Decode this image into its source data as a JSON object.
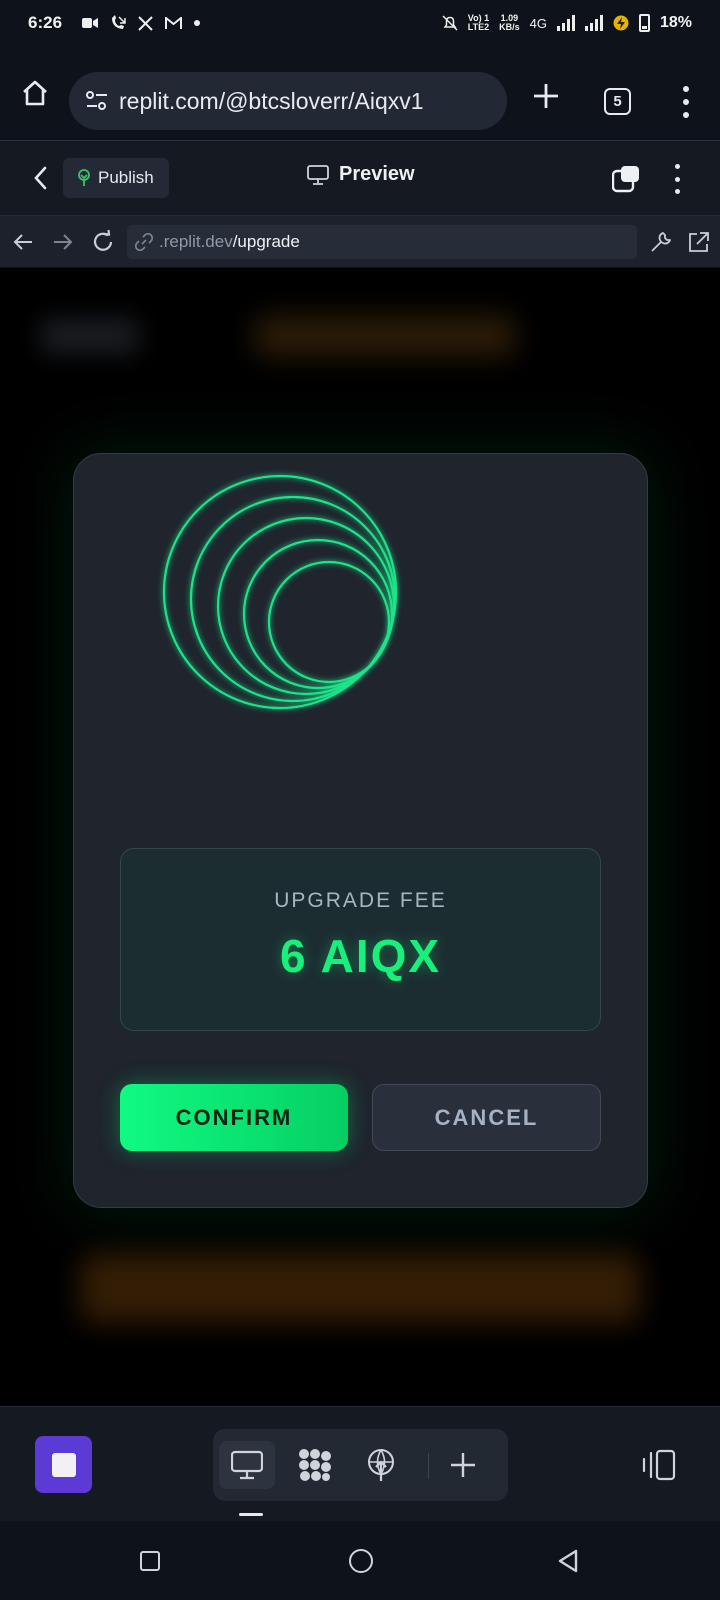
{
  "status_bar": {
    "time": "6:26",
    "volte_line1": "Vo) 1",
    "volte_line2": "LTE2",
    "speed_line1": "1.09",
    "speed_line2": "KB/s",
    "network": "4G",
    "battery": "18%"
  },
  "browser": {
    "url": "replit.com/@btcsloverr/Aiqxv1",
    "tab_count": "5"
  },
  "toolbar": {
    "publish_label": "Publish",
    "preview_label": "Preview"
  },
  "preview_nav": {
    "url_domain": ".replit.dev",
    "url_path": "/upgrade"
  },
  "modal": {
    "fee_label": "UPGRADE FEE",
    "fee_value": "6 AIQX",
    "confirm_label": "CONFIRM",
    "cancel_label": "CANCEL",
    "accent_color": "#19f07c"
  },
  "icons": [
    "home-icon",
    "site-settings-icon",
    "plus-icon",
    "tabs-icon",
    "menu-icon",
    "chevron-left-icon",
    "publish-icon",
    "monitor-icon",
    "windows-icon",
    "arrow-left-icon",
    "arrow-right-icon",
    "reload-icon",
    "link-icon",
    "wrench-icon",
    "external-link-icon",
    "stop-icon",
    "grid-blob-icon",
    "deploy-icon",
    "split-view-icon"
  ]
}
